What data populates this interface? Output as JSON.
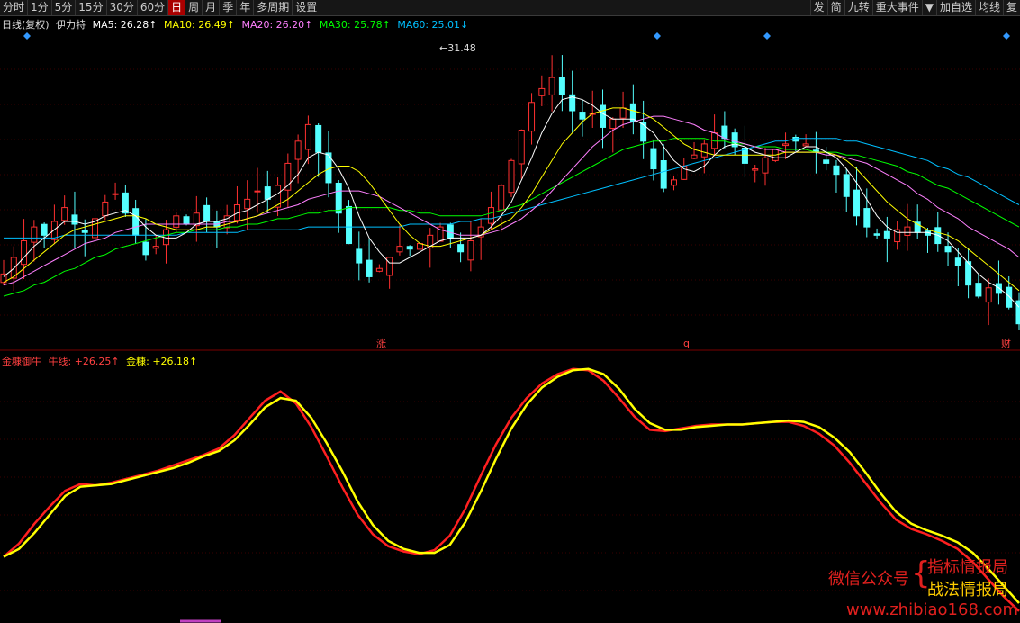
{
  "toolbar": {
    "items": [
      "分时",
      "1分",
      "5分",
      "15分",
      "30分",
      "60分",
      "日",
      "周",
      "月",
      "季",
      "年",
      "多周期",
      "设置"
    ],
    "active_index": 6,
    "right_items": [
      "发",
      "简",
      "九转",
      "重大事件",
      "▼",
      "加自选",
      "均线",
      "复"
    ]
  },
  "price_legend": {
    "period": "日线(复权)",
    "name": "伊力特",
    "ma5": "MA5: 26.28↑",
    "ma10": "MA10: 26.49↑",
    "ma20": "MA20: 26.20↑",
    "ma30": "MA30: 25.78↑",
    "ma60": "MA60: 25.01↓"
  },
  "indicator_legend": {
    "name": "金糠御牛",
    "line1": "牛线: +26.25↑",
    "line2": "金糠: +26.18↑"
  },
  "markers": {
    "high_label": "←31.48",
    "event_zhang": "涨",
    "event_q": "q",
    "event_cai": "财"
  },
  "watermark": {
    "left": "微信公众号",
    "top_right": "指标情报局",
    "bottom_right": "战法情报局",
    "url": "www.zhibiao168.com"
  },
  "colors": {
    "up": "#ff3030",
    "down": "#54ffff",
    "ma5": "#ffffff",
    "ma10": "#ffff00",
    "ma20": "#ff80ff",
    "ma30": "#00ff00",
    "ma60": "#00c0ff",
    "niu": "#ff2020",
    "jin": "#ffff00"
  },
  "chart_data": {
    "type": "candlestick",
    "high_value": 31.48,
    "candles_x_index_range": [
      0,
      100
    ],
    "closes": [
      23.2,
      23.8,
      24.4,
      24.9,
      24.6,
      25.1,
      25.6,
      25.0,
      24.7,
      25.2,
      25.8,
      26.1,
      25.4,
      24.6,
      23.9,
      24.2,
      24.8,
      25.3,
      25.0,
      25.4,
      25.1,
      24.9,
      25.3,
      25.7,
      25.9,
      26.2,
      25.9,
      26.4,
      27.2,
      28.0,
      28.6,
      27.6,
      26.5,
      25.4,
      24.3,
      23.6,
      23.1,
      23.4,
      23.8,
      24.2,
      24.1,
      24.3,
      24.6,
      24.9,
      24.5,
      24.0,
      24.4,
      24.9,
      25.6,
      26.4,
      27.3,
      28.4,
      29.4,
      29.9,
      30.3,
      29.7,
      29.1,
      28.8,
      29.0,
      28.5,
      28.8,
      29.2,
      28.7,
      28.0,
      27.0,
      26.3,
      26.6,
      27.1,
      27.5,
      27.9,
      28.3,
      28.1,
      27.8,
      27.2,
      27.0,
      27.4,
      27.7,
      27.9,
      28.0,
      27.9,
      27.6,
      27.2,
      26.8,
      26.0,
      25.3,
      24.9,
      24.6,
      24.5,
      24.8,
      24.9,
      24.7,
      24.6,
      24.3,
      24.0,
      23.5,
      22.8,
      22.4,
      22.7,
      22.5,
      22.0,
      21.4
    ],
    "ma5": [
      23.1,
      23.4,
      23.8,
      24.2,
      24.5,
      24.8,
      25.1,
      25.1,
      25.0,
      25.1,
      25.3,
      25.4,
      25.5,
      25.3,
      24.9,
      24.6,
      24.5,
      24.5,
      24.7,
      25.0,
      25.1,
      25.1,
      25.2,
      25.4,
      25.5,
      25.7,
      25.9,
      26.1,
      26.4,
      26.8,
      27.4,
      27.6,
      27.5,
      27.0,
      26.3,
      25.3,
      24.5,
      24.0,
      23.6,
      23.6,
      23.8,
      24.0,
      24.2,
      24.4,
      24.5,
      24.5,
      24.5,
      24.6,
      24.9,
      25.3,
      25.8,
      26.6,
      27.4,
      28.3,
      29.0,
      29.5,
      29.6,
      29.5,
      29.3,
      29.0,
      28.8,
      28.8,
      28.8,
      28.6,
      28.3,
      27.8,
      27.3,
      27.0,
      26.9,
      27.1,
      27.5,
      27.8,
      27.9,
      27.8,
      27.6,
      27.5,
      27.4,
      27.4,
      27.6,
      27.8,
      27.8,
      27.6,
      27.4,
      27.0,
      26.5,
      25.9,
      25.3,
      24.9,
      24.7,
      24.7,
      24.7,
      24.7,
      24.6,
      24.4,
      24.0,
      23.6,
      23.2,
      22.9,
      22.7,
      22.4,
      22.0
    ],
    "ma10": [
      22.9,
      23.1,
      23.4,
      23.7,
      24.0,
      24.3,
      24.6,
      24.8,
      24.9,
      25.0,
      25.1,
      25.2,
      25.3,
      25.3,
      25.2,
      25.0,
      24.9,
      24.8,
      24.8,
      24.8,
      24.9,
      24.9,
      25.0,
      25.1,
      25.2,
      25.3,
      25.5,
      25.7,
      25.9,
      26.2,
      26.5,
      26.8,
      27.0,
      27.1,
      27.1,
      26.9,
      26.5,
      26.0,
      25.5,
      25.0,
      24.6,
      24.3,
      24.2,
      24.2,
      24.3,
      24.4,
      24.5,
      24.6,
      24.8,
      25.0,
      25.2,
      25.6,
      26.1,
      26.7,
      27.3,
      27.9,
      28.3,
      28.7,
      29.0,
      29.1,
      29.2,
      29.2,
      29.1,
      29.0,
      28.8,
      28.5,
      28.2,
      27.9,
      27.7,
      27.6,
      27.5,
      27.5,
      27.5,
      27.5,
      27.5,
      27.5,
      27.5,
      27.6,
      27.6,
      27.6,
      27.6,
      27.6,
      27.5,
      27.3,
      27.0,
      26.6,
      26.2,
      25.8,
      25.5,
      25.2,
      25.0,
      24.8,
      24.7,
      24.6,
      24.4,
      24.1,
      23.8,
      23.5,
      23.2,
      22.9,
      22.6
    ],
    "ma20": [
      22.8,
      22.9,
      23.1,
      23.3,
      23.5,
      23.7,
      23.9,
      24.1,
      24.3,
      24.4,
      24.5,
      24.7,
      24.8,
      24.9,
      25.0,
      25.0,
      25.0,
      25.0,
      25.0,
      25.0,
      25.0,
      25.0,
      25.1,
      25.1,
      25.2,
      25.3,
      25.4,
      25.5,
      25.6,
      25.7,
      25.9,
      26.0,
      26.1,
      26.2,
      26.2,
      26.2,
      26.1,
      26.0,
      25.8,
      25.6,
      25.4,
      25.2,
      25.0,
      24.8,
      24.7,
      24.6,
      24.6,
      24.6,
      24.7,
      24.8,
      25.0,
      25.2,
      25.5,
      25.8,
      26.2,
      26.6,
      27.0,
      27.4,
      27.8,
      28.1,
      28.4,
      28.6,
      28.7,
      28.8,
      28.9,
      28.9,
      28.8,
      28.7,
      28.6,
      28.4,
      28.3,
      28.1,
      28.0,
      27.9,
      27.8,
      27.7,
      27.7,
      27.6,
      27.6,
      27.6,
      27.6,
      27.5,
      27.5,
      27.4,
      27.3,
      27.2,
      27.0,
      26.8,
      26.6,
      26.4,
      26.1,
      25.9,
      25.6,
      25.4,
      25.2,
      24.9,
      24.7,
      24.5,
      24.3,
      24.1,
      23.8
    ],
    "ma30": [
      22.4,
      22.5,
      22.6,
      22.8,
      22.9,
      23.1,
      23.3,
      23.4,
      23.6,
      23.8,
      23.9,
      24.1,
      24.2,
      24.3,
      24.4,
      24.5,
      24.6,
      24.7,
      24.7,
      24.8,
      24.8,
      24.8,
      24.9,
      24.9,
      25.0,
      25.0,
      25.1,
      25.2,
      25.2,
      25.3,
      25.4,
      25.4,
      25.5,
      25.5,
      25.6,
      25.6,
      25.6,
      25.6,
      25.6,
      25.5,
      25.5,
      25.4,
      25.4,
      25.3,
      25.3,
      25.3,
      25.3,
      25.3,
      25.4,
      25.5,
      25.6,
      25.7,
      25.9,
      26.1,
      26.3,
      26.5,
      26.7,
      26.9,
      27.1,
      27.3,
      27.5,
      27.7,
      27.8,
      27.9,
      28.0,
      28.0,
      28.1,
      28.1,
      28.1,
      28.1,
      28.0,
      28.0,
      27.9,
      27.9,
      27.8,
      27.8,
      27.8,
      27.7,
      27.7,
      27.7,
      27.6,
      27.6,
      27.6,
      27.5,
      27.5,
      27.4,
      27.3,
      27.2,
      27.1,
      26.9,
      26.8,
      26.6,
      26.4,
      26.3,
      26.1,
      25.9,
      25.7,
      25.5,
      25.3,
      25.1,
      24.9
    ],
    "ma60": [
      24.5,
      24.5,
      24.5,
      24.5,
      24.5,
      24.5,
      24.6,
      24.6,
      24.6,
      24.6,
      24.6,
      24.6,
      24.6,
      24.6,
      24.6,
      24.6,
      24.6,
      24.6,
      24.7,
      24.7,
      24.7,
      24.7,
      24.7,
      24.7,
      24.8,
      24.8,
      24.8,
      24.8,
      24.8,
      24.8,
      24.9,
      24.9,
      24.9,
      24.9,
      24.9,
      24.9,
      24.9,
      24.9,
      24.9,
      24.9,
      25.0,
      25.0,
      25.0,
      25.0,
      25.0,
      25.1,
      25.1,
      25.2,
      25.2,
      25.3,
      25.4,
      25.5,
      25.6,
      25.7,
      25.8,
      25.9,
      26.0,
      26.1,
      26.2,
      26.3,
      26.4,
      26.5,
      26.6,
      26.7,
      26.8,
      26.9,
      27.0,
      27.1,
      27.2,
      27.3,
      27.4,
      27.5,
      27.6,
      27.7,
      27.8,
      27.9,
      28.0,
      28.0,
      28.1,
      28.1,
      28.1,
      28.1,
      28.1,
      28.0,
      28.0,
      27.9,
      27.8,
      27.7,
      27.6,
      27.5,
      27.4,
      27.3,
      27.1,
      27.0,
      26.8,
      26.7,
      26.5,
      26.3,
      26.1,
      25.9,
      25.7
    ],
    "niu": [
      20,
      21,
      22.5,
      23.8,
      25,
      25.5,
      25.4,
      25.6,
      25.9,
      26.2,
      26.5,
      26.9,
      27.3,
      27.7,
      28.2,
      29.2,
      30.5,
      31.8,
      32.5,
      31.6,
      29.8,
      27.6,
      25.3,
      23.2,
      21.7,
      20.8,
      20.4,
      20.2,
      20.5,
      21.6,
      23.6,
      26.1,
      28.5,
      30.5,
      32.0,
      33.1,
      33.8,
      34.2,
      34.1,
      33.3,
      32.0,
      30.6,
      29.6,
      29.5,
      29.7,
      29.9,
      30.0,
      30.0,
      30.0,
      30.1,
      30.2,
      30.2,
      29.9,
      29.3,
      28.4,
      27.1,
      25.6,
      24.1,
      22.8,
      22.1,
      21.7,
      21.2,
      20.6,
      19.6,
      18.3,
      17.0,
      15.9
    ],
    "jin": [
      20,
      20.6,
      21.8,
      23.2,
      24.6,
      25.3,
      25.4,
      25.5,
      25.8,
      26.1,
      26.4,
      26.7,
      27.1,
      27.6,
      28.0,
      28.8,
      30.0,
      31.3,
      32.0,
      31.8,
      30.5,
      28.6,
      26.5,
      24.2,
      22.4,
      21.2,
      20.6,
      20.3,
      20.3,
      20.9,
      22.6,
      24.9,
      27.4,
      29.7,
      31.5,
      32.8,
      33.6,
      34.1,
      34.2,
      33.8,
      32.7,
      31.2,
      30.1,
      29.6,
      29.6,
      29.8,
      29.9,
      30.0,
      30.0,
      30.1,
      30.2,
      30.3,
      30.2,
      29.8,
      29.0,
      27.9,
      26.4,
      24.8,
      23.4,
      22.5,
      22.0,
      21.6,
      21.1,
      20.3,
      19.1,
      17.8,
      16.5
    ]
  }
}
